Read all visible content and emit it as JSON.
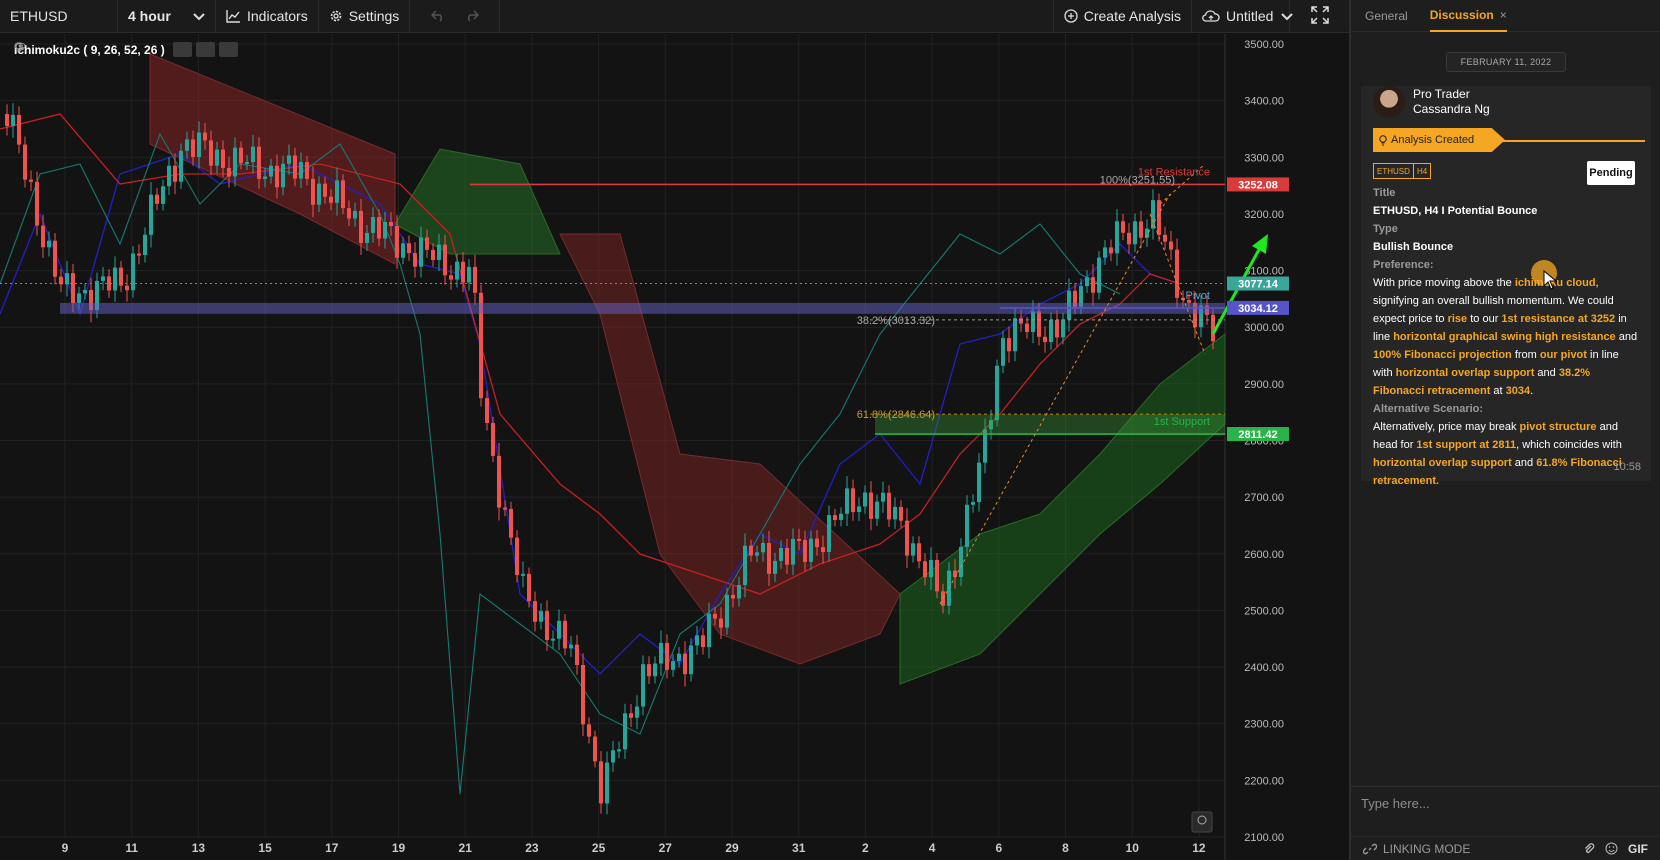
{
  "toolbar": {
    "symbol": "ETHUSD",
    "interval": "4 hour",
    "indicators": "Indicators",
    "settings": "Settings",
    "create_analysis": "Create Analysis",
    "layout_name": "Untitled"
  },
  "indicator": {
    "name": "Ichimoku2c ( 9, 26, 52, 26 )"
  },
  "chart_data": {
    "type": "candlestick",
    "symbol": "ETHUSD",
    "y_ticks": [
      "3500.00",
      "3400.00",
      "3300.00",
      "3200.00",
      "3100.00",
      "3000.00",
      "2900.00",
      "2800.00",
      "2700.00",
      "2600.00",
      "2500.00",
      "2400.00",
      "2300.00",
      "2200.00",
      "2100.00"
    ],
    "ylim": [
      2100,
      3500
    ],
    "x_ticks": [
      "9",
      "11",
      "13",
      "15",
      "17",
      "19",
      "21",
      "23",
      "25",
      "27",
      "29",
      "31",
      "2",
      "4",
      "6",
      "8",
      "10",
      "12"
    ],
    "price_labels": [
      {
        "text": "3252.08",
        "color": "#d93a3a",
        "value": 3252.08
      },
      {
        "text": "3077.14",
        "color": "#3aa69a",
        "value": 3077.14
      },
      {
        "text": "3034.12",
        "color": "#5555c8",
        "value": 3034.12
      },
      {
        "text": "2811.42",
        "color": "#29b34a",
        "value": 2811.42
      }
    ],
    "annotations": {
      "resistance": "1st Resistance",
      "support": "1st Support",
      "pivot": "Pivot",
      "fib_100": "100%(3251.55)",
      "fib_382": "38.2%(3013.32)",
      "fib_618": "61.8%(2846.64)"
    },
    "grid": true,
    "colors": {
      "up": "#26a69a",
      "down": "#ef5350",
      "resistance": "#d93a3a",
      "support": "#29b34a",
      "pivot": "#5555c8"
    }
  },
  "panel": {
    "tabs": [
      {
        "label": "General"
      },
      {
        "label": "Discussion"
      }
    ],
    "date": "FEBRUARY 11, 2022",
    "author_role": "Pro Trader",
    "author_name": "Cassandra Ng",
    "created_label": "Analysis Created",
    "tags": [
      "ETHUSD",
      "H4"
    ],
    "status": "Pending",
    "title_label": "Title",
    "title_value": "ETHUSD, H4 I Potential Bounce",
    "type_label": "Type",
    "type_value": "Bullish Bounce",
    "pref_label": "Preference:",
    "pref": {
      "t1": "With price moving above the ",
      "h1": "ichimoku cloud",
      "t2": ", signifying an overall bullish momentum. We could expect price to ",
      "h2": "rise",
      "t3": " to our ",
      "h3": "1st resistance at 3252",
      "t4": " in line ",
      "h4": "horizontal graphical swing high resistance",
      "t5": " and ",
      "h5": "100% Fibonacci projection",
      "t6": " from ",
      "h6": "our pivot",
      "t7": " in line with ",
      "h7": "horizontal overlap support",
      "t8": " and ",
      "h8": "38.2% Fibonacci retracement",
      "t9": " at ",
      "h9": "3034",
      "t10": "."
    },
    "alt_label": "Alternative Scenario:",
    "alt": {
      "t1": "Alternatively, price may break ",
      "h1": "pivot structure",
      "t2": " and head for ",
      "h2": "1st support at 2811",
      "t3": ", which coincides with ",
      "h3": "horizontal overlap support",
      "t4": " and ",
      "h4": "61.8% Fibonacci retracement.",
      "t5": ""
    },
    "time": "10:58",
    "input_placeholder": "Type here...",
    "linking_mode": "LINKING MODE",
    "gif": "GIF"
  }
}
